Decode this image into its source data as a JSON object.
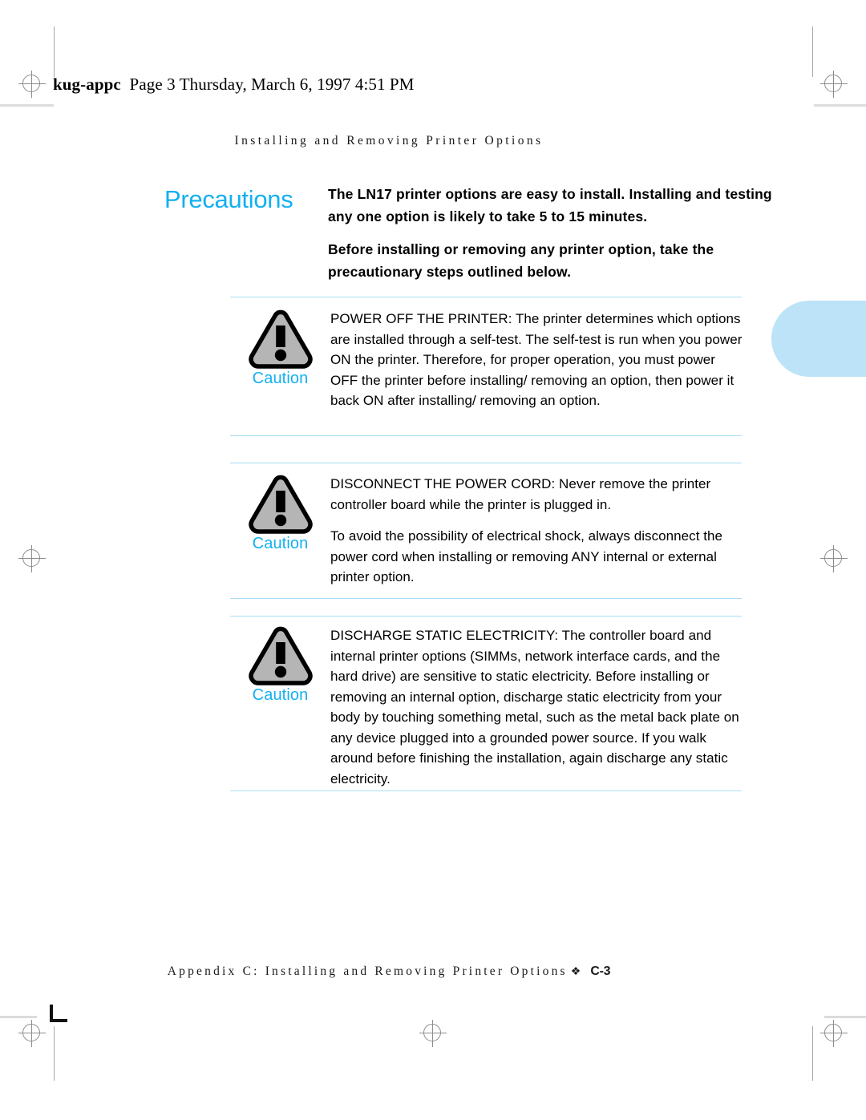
{
  "page": {
    "file_stamp_name": "kug-appc",
    "file_stamp_rest": "Page 3  Thursday, March 6, 1997  4:51 PM",
    "running_header": "Installing and Removing Printer Options",
    "tab_color": "#bce3f8",
    "accent_color": "#12b0f0",
    "rule_color": "#a9ddf4"
  },
  "section": {
    "title": "Precautions",
    "intro_paragraphs": [
      "The LN17 printer options are easy to install. Installing and testing any one option is likely to take 5 to 15 minutes.",
      "Before installing or removing any printer option, take the precautionary steps outlined below."
    ]
  },
  "cautions": [
    {
      "label": "Caution",
      "icon": "warning-triangle-icon",
      "paragraphs": [
        "POWER OFF THE PRINTER: The printer determines which options are installed through a self-test. The self-test is run when you power ON the printer. Therefore, for proper operation, you must power OFF the printer before installing/ removing an option, then power it back ON after installing/ removing an option."
      ]
    },
    {
      "label": "Caution",
      "icon": "warning-triangle-icon",
      "paragraphs": [
        "DISCONNECT THE POWER CORD: Never remove the printer controller board while the printer is plugged in.",
        "To avoid the possibility of electrical shock, always disconnect the power cord when installing or removing ANY internal or external printer option."
      ]
    },
    {
      "label": "Caution",
      "icon": "warning-triangle-icon",
      "paragraphs": [
        "DISCHARGE STATIC ELECTRICITY: The controller board and internal printer options (SIMMs, network interface cards, and the hard drive) are sensitive to static electricity. Before installing or removing an internal option, discharge static electricity from your body by touching something metal, such as the metal back plate on any device plugged into a grounded power source. If you walk around before finishing the installation, again discharge any static electricity."
      ]
    }
  ],
  "footer": {
    "text": "Appendix C: Installing and Removing Printer Options",
    "diamond": "❖",
    "page_number": "C-3"
  }
}
